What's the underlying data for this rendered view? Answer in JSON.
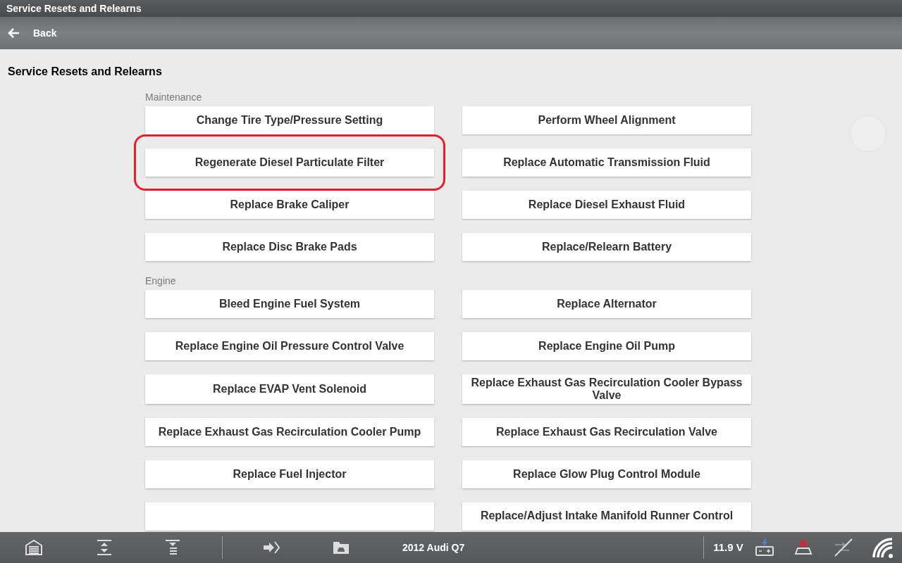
{
  "window": {
    "title": "Service Resets and Relearns"
  },
  "nav": {
    "back_label": "Back"
  },
  "page_title": "Service Resets and Relearns",
  "sections": [
    {
      "label": "Maintenance",
      "rows": [
        [
          {
            "label": "Change Tire Type/Pressure Setting",
            "highlighted": false
          },
          {
            "label": "Perform Wheel Alignment",
            "highlighted": false
          }
        ],
        [
          {
            "label": "Regenerate Diesel Particulate Filter",
            "highlighted": true
          },
          {
            "label": "Replace Automatic Transmission Fluid",
            "highlighted": false
          }
        ],
        [
          {
            "label": "Replace Brake Caliper",
            "highlighted": false
          },
          {
            "label": "Replace Diesel Exhaust Fluid",
            "highlighted": false
          }
        ],
        [
          {
            "label": "Replace Disc Brake Pads",
            "highlighted": false
          },
          {
            "label": "Replace/Relearn Battery",
            "highlighted": false
          }
        ]
      ]
    },
    {
      "label": "Engine",
      "rows": [
        [
          {
            "label": "Bleed Engine Fuel System",
            "highlighted": false
          },
          {
            "label": "Replace Alternator",
            "highlighted": false
          }
        ],
        [
          {
            "label": "Replace Engine Oil Pressure Control Valve",
            "highlighted": false
          },
          {
            "label": "Replace Engine Oil Pump",
            "highlighted": false
          }
        ],
        [
          {
            "label": "Replace EVAP Vent Solenoid",
            "highlighted": false
          },
          {
            "label": "Replace Exhaust Gas Recirculation Cooler Bypass Valve",
            "highlighted": false
          }
        ],
        [
          {
            "label": "Replace Exhaust Gas Recirculation Cooler Pump",
            "highlighted": false
          },
          {
            "label": "Replace Exhaust Gas Recirculation Valve",
            "highlighted": false
          }
        ],
        [
          {
            "label": "Replace Fuel Injector",
            "highlighted": false
          },
          {
            "label": "Replace Glow Plug Control Module",
            "highlighted": false
          }
        ],
        [
          {
            "highlighted": false
          },
          {
            "label": "Replace/Adjust Intake Manifold Runner Control",
            "highlighted": false
          }
        ]
      ]
    }
  ],
  "status_bar": {
    "vehicle": "2012 Audi Q7",
    "voltage": "11.9 V"
  }
}
